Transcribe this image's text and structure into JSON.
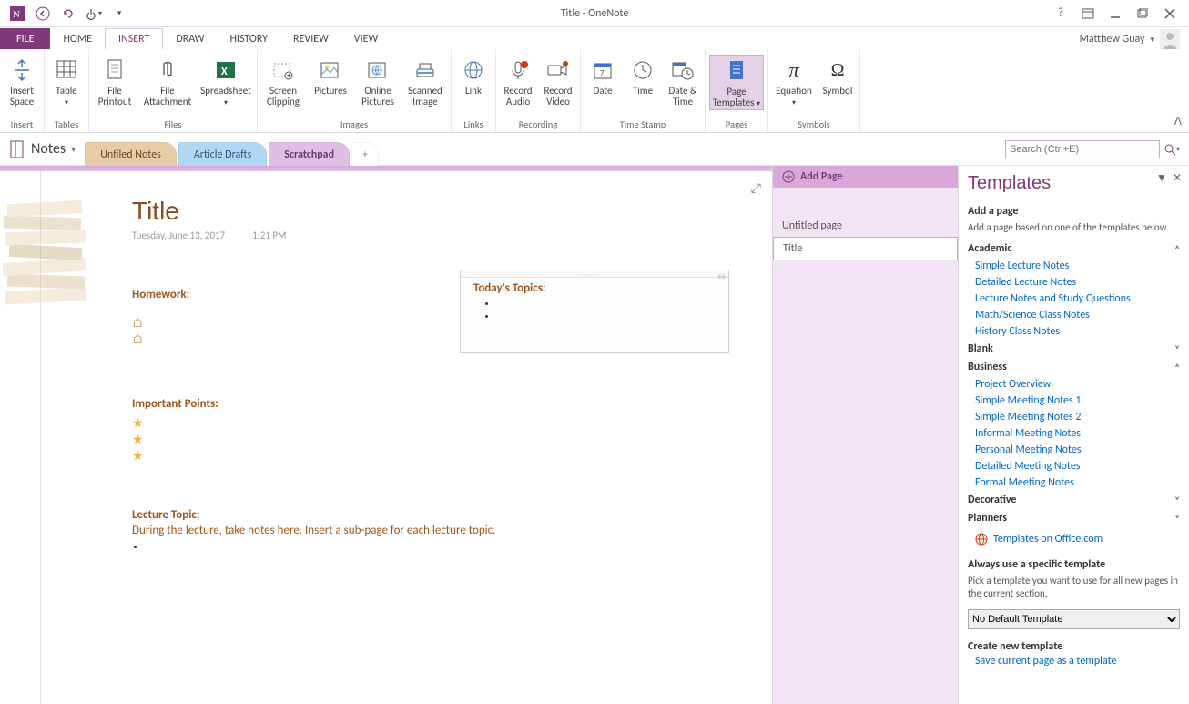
{
  "titlebar": {
    "center": "Title - OneNote",
    "user": "Matthew Guay"
  },
  "tabs": {
    "file": "FILE",
    "home": "HOME",
    "insert": "INSERT",
    "draw": "DRAW",
    "history": "HISTORY",
    "review": "REVIEW",
    "view": "VIEW"
  },
  "ribbon": {
    "groups": {
      "insert": {
        "label": "Insert",
        "insert_space": "Insert Space"
      },
      "tables": {
        "label": "Tables",
        "table": "Table"
      },
      "files": {
        "label": "Files",
        "printout": "File Printout",
        "attachment": "File Attachment",
        "spreadsheet": "Spreadsheet"
      },
      "images": {
        "label": "Images",
        "clipping": "Screen Clipping",
        "pictures": "Pictures",
        "online": "Online Pictures",
        "scanned": "Scanned Image"
      },
      "links": {
        "label": "Links",
        "link": "Link"
      },
      "recording": {
        "label": "Recording",
        "audio": "Record Audio",
        "video": "Record Video"
      },
      "timestamp": {
        "label": "Time Stamp",
        "date": "Date",
        "time": "Time",
        "datetime": "Date & Time"
      },
      "pages": {
        "label": "Pages",
        "templates": "Page Templates"
      },
      "symbols": {
        "label": "Symbols",
        "equation": "Equation",
        "symbol": "Symbol"
      }
    }
  },
  "sections": {
    "notebook": "Notes",
    "unfiled": "Unfiled Notes",
    "drafts": "Article Drafts",
    "scratch": "Scratchpad",
    "add": "+"
  },
  "search": {
    "placeholder": "Search (Ctrl+E)"
  },
  "page": {
    "title": "Title",
    "date": "Tuesday, June 13, 2017",
    "time": "1:21 PM",
    "homework": "Homework:",
    "important": "Important Points:",
    "topics": "Today's Topics:",
    "lecture_topic": "Lecture Topic:",
    "lecture_text": "During the lecture, take notes here.  Insert a sub-page for each lecture topic."
  },
  "pagelist": {
    "add": "Add Page",
    "untitled": "Untitled page",
    "title": "Title"
  },
  "templates": {
    "title": "Templates",
    "add_page": "Add a page",
    "add_desc": "Add a page based on one of the templates below.",
    "academic": {
      "label": "Academic",
      "items": [
        "Simple Lecture Notes",
        "Detailed Lecture Notes",
        "Lecture Notes and Study Questions",
        "Math/Science Class Notes",
        "History Class Notes"
      ]
    },
    "blank": {
      "label": "Blank"
    },
    "business": {
      "label": "Business",
      "items": [
        "Project Overview",
        "Simple Meeting Notes 1",
        "Simple Meeting Notes 2",
        "Informal Meeting Notes",
        "Personal Meeting Notes",
        "Detailed Meeting Notes",
        "Formal Meeting Notes"
      ]
    },
    "decorative": {
      "label": "Decorative"
    },
    "planners": {
      "label": "Planners"
    },
    "office_link": "Templates on Office.com",
    "always": "Always use a specific template",
    "always_desc": "Pick a template you want to use for all new pages in the current section.",
    "default_select": "No Default Template",
    "create": "Create new template",
    "save_link": "Save current page as a template"
  }
}
